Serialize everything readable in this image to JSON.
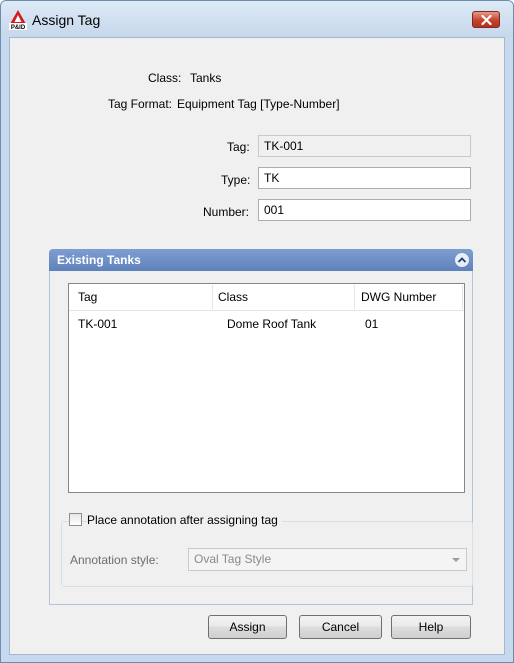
{
  "window": {
    "title": "Assign Tag"
  },
  "info": {
    "class_label": "Class:",
    "class_value": "Tanks",
    "format_label": "Tag Format:",
    "format_value": "Equipment Tag [Type-Number]"
  },
  "fields": {
    "tag_label": "Tag:",
    "tag_value": "TK-001",
    "type_label": "Type:",
    "type_value": "TK",
    "number_label": "Number:",
    "number_value": "001"
  },
  "existing": {
    "header": "Existing Tanks",
    "columns": [
      "Tag",
      "Class",
      "DWG Number"
    ],
    "rows": [
      [
        "TK-001",
        "Dome Roof Tank",
        "01"
      ]
    ]
  },
  "annotation": {
    "checkbox_label": "Place annotation after assigning tag",
    "checked": false,
    "style_label": "Annotation style:",
    "style_value": "Oval Tag Style"
  },
  "buttons": {
    "assign": "Assign",
    "cancel": "Cancel",
    "help": "Help"
  },
  "colors": {
    "header_blue": "#5f82bb",
    "close_red": "#c5432b",
    "window_frame": "#c7d9ee"
  },
  "icons": {
    "app": "pid-app-icon",
    "close": "close-icon",
    "collapse": "chevron-up-icon",
    "dropdown": "dropdown-arrow-icon"
  }
}
